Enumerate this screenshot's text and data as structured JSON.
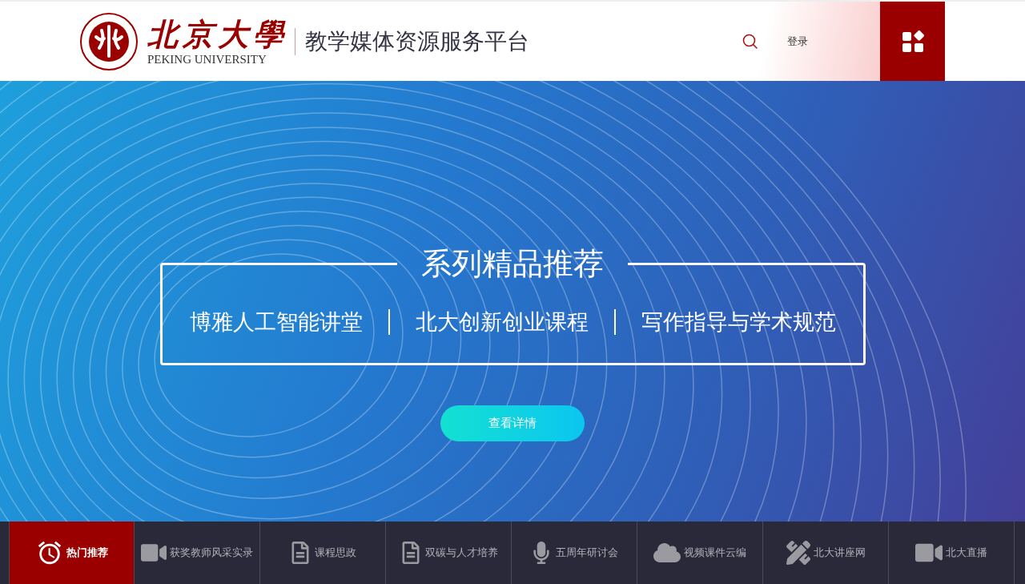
{
  "header": {
    "logo_chinese": "北京大學",
    "logo_english": "PEKING UNIVERSITY",
    "platform_title": "教学媒体资源服务平台",
    "login": "登录"
  },
  "banner": {
    "title": "系列精品推荐",
    "series": [
      "博雅人工智能讲堂",
      "北大创新创业课程",
      "写作指导与学术规范"
    ],
    "button": "查看详情"
  },
  "nav": [
    {
      "label": "热门推荐",
      "kind": "alarm",
      "selected": true
    },
    {
      "label": "获奖教师风采实录",
      "kind": "camera",
      "selected": false
    },
    {
      "label": "课程思政",
      "kind": "document",
      "selected": false
    },
    {
      "label": "双碳与人才培养",
      "kind": "document",
      "selected": false
    },
    {
      "label": "五周年研讨会",
      "kind": "microphone",
      "selected": false
    },
    {
      "label": "视频课件云编",
      "kind": "cloud",
      "selected": false
    },
    {
      "label": "北大讲座网",
      "kind": "pencil-ruler",
      "selected": false
    },
    {
      "label": "北大直播",
      "kind": "video",
      "selected": false
    }
  ]
}
